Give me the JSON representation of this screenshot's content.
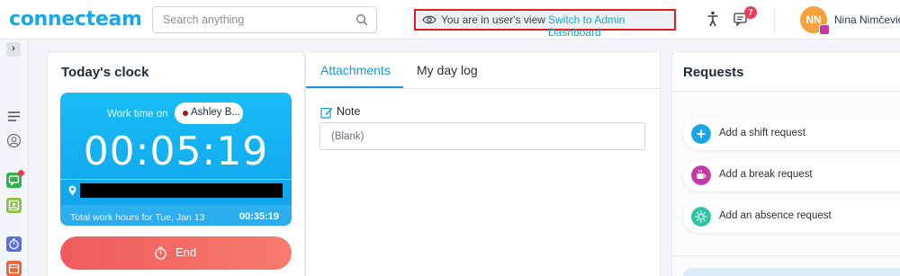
{
  "brand": {
    "logo_text": "connecteam"
  },
  "topbar": {
    "search_placeholder": "Search anything",
    "view_notice": "You are in user's view",
    "switch_link": "Switch to Admin Dashboard",
    "chat_badge": "7",
    "user_initials": "NN",
    "user_name": "Nina Nimčević"
  },
  "clock": {
    "title": "Today's clock",
    "work_time_on": "Work time on",
    "job_name": "Ashley B...",
    "timer": "00:05:19",
    "total_label": "Total work hours for Tue, Jan 13",
    "total_value": "00:35:19",
    "end_label": "End"
  },
  "middle": {
    "tabs": [
      {
        "label": "Attachments",
        "active": true
      },
      {
        "label": "My day log",
        "active": false
      }
    ],
    "note_label": "Note",
    "note_value": "(Blank)"
  },
  "requests": {
    "title": "Requests",
    "items": [
      {
        "label": "Add a shift request",
        "icon": "plus-icon",
        "color": "#1aa7e8"
      },
      {
        "label": "Add a break request",
        "icon": "coffee-icon",
        "color": "#c23aa8"
      },
      {
        "label": "Add an absence request",
        "icon": "sun-icon",
        "color": "#2ec4a6"
      }
    ]
  },
  "colors": {
    "accent": "#1aa7e8",
    "end_button": "#f05b5d",
    "highlight_border": "#e21b23"
  }
}
